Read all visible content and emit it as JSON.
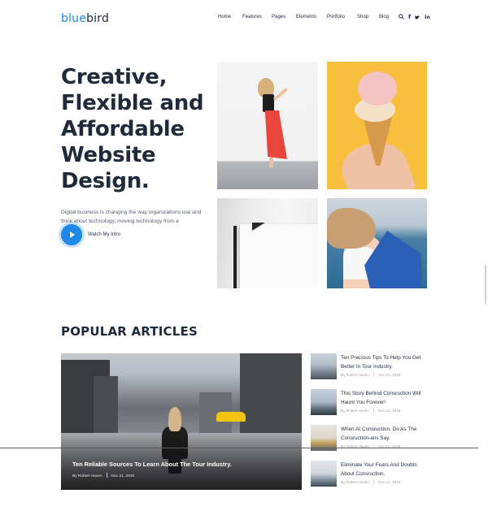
{
  "header": {
    "logo_part1": "blue",
    "logo_part2": "bird",
    "nav": [
      "Home",
      "Features",
      "Pages",
      "Elements",
      "Portfolio",
      "Shop",
      "Blog"
    ],
    "icons": [
      "search-icon",
      "facebook-icon",
      "twitter-icon",
      "linkedin-icon"
    ]
  },
  "hero": {
    "title_lines": [
      "Creative,",
      "Flexible and",
      "Affordable",
      "Website",
      "Design."
    ],
    "description": "Digital business is changing the way organizations use and think about technology, moving technology from a",
    "watch_label": "Watch My Intro"
  },
  "popular": {
    "title": "POPULAR ARTICLES",
    "featured": {
      "title": "Ten Reliable Sources To Learn About The Tour Industry.",
      "author": "By Robert Haven",
      "date": "Dec 21, 2019"
    },
    "articles": [
      {
        "title": "Ten Precious Tips To Help You Get Better In Tour Industry.",
        "author": "By Robert Haven",
        "date": "Dec 21, 2019"
      },
      {
        "title": "This Story Behind Consruction Will Haunt You Forever!",
        "author": "By Robert Haven",
        "date": "Dec 21, 2019"
      },
      {
        "title": "When At Consruction, Do As The Consruction-ans Say.",
        "author": "By Robert Haven",
        "date": "Dec 21, 2019"
      },
      {
        "title": "Eliminate Your Fears And Doubts About Consruction.",
        "author": "By Robert Haven",
        "date": "Dec 21, 2019"
      }
    ]
  },
  "colors": {
    "accent": "#1e88e5",
    "heading": "#1f2a3a",
    "ice_cream_bg": "#f8bf3f",
    "skirt": "#e8453c",
    "taxi": "#f1c40f"
  }
}
